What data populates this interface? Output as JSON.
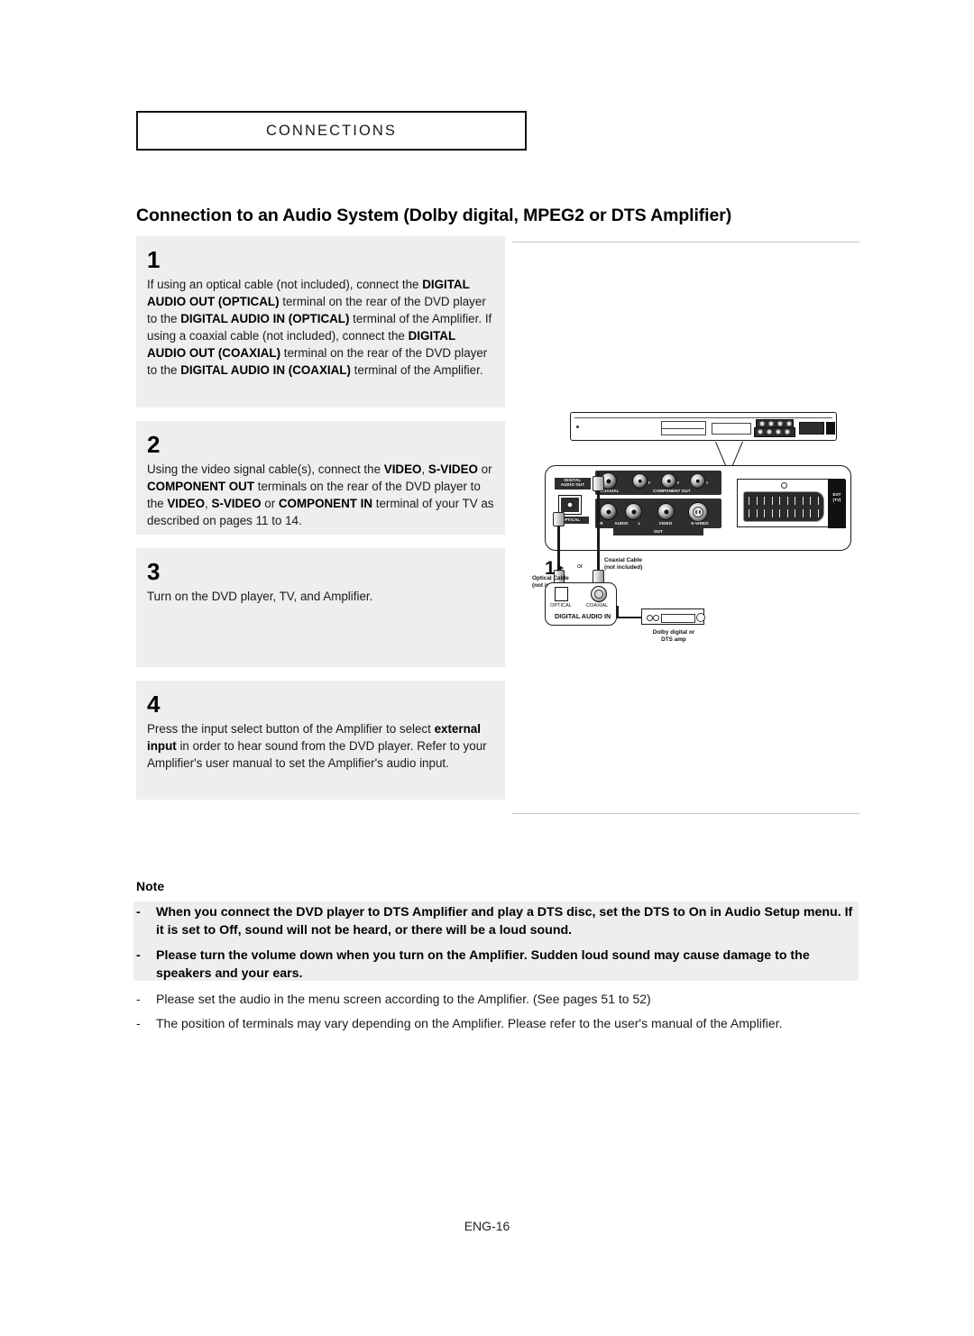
{
  "header": {
    "chapter": "CONNECTIONS",
    "page_title": "Connection to an Audio System (Dolby digital, MPEG2 or DTS Amplifier)"
  },
  "steps": [
    {
      "number": "1",
      "lines": [
        "If using an optical cable (not included), connect the ",
        "DIGITAL AUDIO OUT (OPTICAL)",
        " terminal on the rear of the DVD player to the ",
        "DIGITAL AUDIO IN (OPTICAL)",
        " terminal of the Amplifier."
      ],
      "lines2": [
        "If using a coaxial cable (not included), connect the ",
        "DIGITAL AUDIO OUT (COAXIAL)",
        " terminal on the rear of the DVD player to the ",
        "DIGITAL AUDIO IN (COAXIAL)",
        " terminal of the Amplifier."
      ]
    },
    {
      "number": "2",
      "lines": [
        "Using the video signal cable(s), connect the ",
        "VIDEO",
        ", ",
        "S-VIDEO",
        " or ",
        "COMPONENT OUT",
        " terminals on the rear of the DVD player to the ",
        "VIDEO",
        ", ",
        "S-VIDEO",
        " or ",
        "COMPONENT IN",
        " terminal of your TV as described on pages 11 to 14."
      ]
    },
    {
      "number": "3",
      "text": "Turn on the DVD player, TV, and Amplifier."
    },
    {
      "number": "4",
      "lines": [
        "Press the input select button of the Amplifier to select ",
        "external input",
        " in order to hear sound from the DVD player.",
        "Refer to your Amplifier's user manual to set the Amplifier's audio input."
      ]
    }
  ],
  "diagram": {
    "step_marker": "1",
    "or_label": "or",
    "optical_cable_label": "Optical Cable\n(not included)",
    "optical_cable_l1": "Optical Cable",
    "optical_cable_l2": "(not included)",
    "coaxial_cable_l1": "Coaxial Cable",
    "coaxial_cable_l2": "(not included)",
    "digital_audio_out": "DIGITAL\nAUDIO OUT",
    "digital_audio_out_l1": "DIGITAL",
    "digital_audio_out_l2": "AUDIO OUT",
    "optical_port": "OPTICAL",
    "coaxial_port": "COAXIAL",
    "component_out": "COMPONENT OUT",
    "component_pr": "P",
    "component_pb": "P",
    "component_y": "Y",
    "audio_r": "R",
    "audio_label": "AUDIO",
    "audio_l": "L",
    "video": "VIDEO",
    "svideo": "S-VIDEO",
    "out": "OUT",
    "ext_tv_l1": "EXT",
    "ext_tv_l2": "(TV)",
    "digital_audio_in": "DIGITAL AUDIO IN",
    "amp_in_optical": "OPTICAL",
    "amp_in_coaxial": "COAXIAL",
    "amp_l1": "Dolby digital or",
    "amp_l2": "DTS amp"
  },
  "note": {
    "heading": "Note",
    "items": [
      {
        "dash": "-",
        "text": "When you connect the DVD player to DTS Amplifier and play a DTS disc, set the DTS to On in Audio Setup menu. If it is set to Off, sound will not be heard, or there will be a loud sound.",
        "bold": true
      },
      {
        "dash": "-",
        "text": "Please turn the volume down when you turn on the Amplifier. Sudden loud sound may cause damage to the speakers and your ears.",
        "bold": true
      },
      {
        "dash": "-",
        "text": "Please set the audio in the menu screen according to the Amplifier. (See pages 51 to 52)",
        "bold": false
      },
      {
        "dash": "-",
        "text": "The position of terminals may vary depending on the Amplifier. Please refer to the user's manual of the Amplifier.",
        "bold": false
      }
    ]
  },
  "footer": {
    "page_number": "ENG-16"
  }
}
